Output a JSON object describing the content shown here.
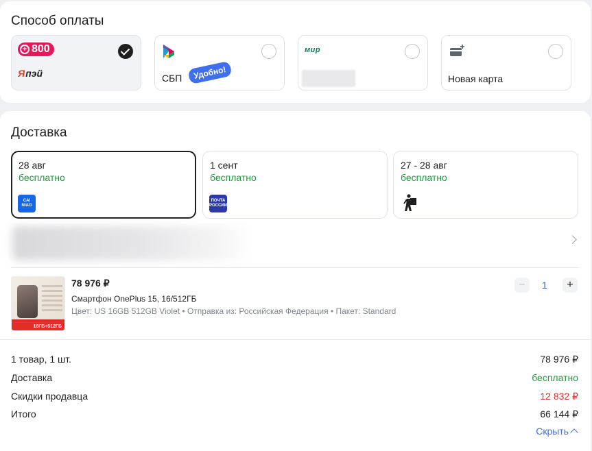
{
  "payment": {
    "title": "Способ оплаты",
    "options": [
      {
        "badge": "800",
        "brand": "пэй",
        "brand_prefix": "Я",
        "selected": true
      },
      {
        "label": "СБП",
        "tag": "Удобно!",
        "selected": false
      },
      {
        "brand": "мир",
        "selected": false
      },
      {
        "label": "Новая карта",
        "selected": false
      }
    ]
  },
  "delivery": {
    "title": "Доставка",
    "options": [
      {
        "date": "28 авг",
        "price": "бесплатно",
        "logo_text": "CAI NIAO",
        "selected": true
      },
      {
        "date": "1 сент",
        "price": "бесплатно",
        "logo_text": "ПОЧТА РОССИИ",
        "selected": false
      },
      {
        "date": "27 - 28 авг",
        "price": "бесплатно",
        "icon": "courier-icon",
        "selected": false
      }
    ]
  },
  "item": {
    "price": "78 976 ₽",
    "name": "Смартфон OnePlus 15, 16/512ГБ",
    "meta": "Цвет: US 16GB 512GB Violet • Отправка из: Российская Федерация • Пакет: Standard",
    "thumb_caption": "16ГБ+512ГБ",
    "qty": "1",
    "minus": "−",
    "plus": "+"
  },
  "summary": {
    "rows": [
      {
        "label": "1 товар, 1 шт.",
        "value": "78 976 ₽"
      },
      {
        "label": "Доставка",
        "value": "бесплатно"
      },
      {
        "label": "Скидки продавца",
        "value": "12 832 ₽"
      },
      {
        "label": "Итого",
        "value": "66 144 ₽"
      }
    ],
    "hide": "Скрыть"
  },
  "colors": {
    "green": "#1a9e3a",
    "red": "#e12d2d",
    "link": "#3a6de0",
    "cainiao": "#1667e8",
    "pochta": "#2c3aa8"
  }
}
